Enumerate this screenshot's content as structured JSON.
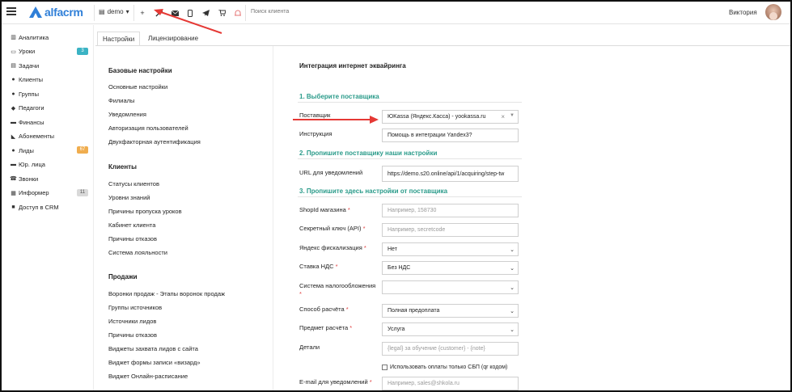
{
  "topbar": {
    "logo_text": "alfacrm",
    "account": "demo",
    "icons": [
      "plus-icon",
      "wrench-icon",
      "envelope-icon",
      "mobile-icon",
      "telegram-icon",
      "cart-icon",
      "bell-icon"
    ],
    "search_placeholder": "Поиск клиента",
    "user_name": "Виктория"
  },
  "sidebar": {
    "items": [
      {
        "label": "Аналитика",
        "icon": "dashboard-icon",
        "glyph": "▥"
      },
      {
        "label": "Уроки",
        "icon": "calendar-icon",
        "glyph": "▭",
        "badge": "3",
        "badge_color": "#3bb3c4"
      },
      {
        "label": "Задачи",
        "icon": "tasks-icon",
        "glyph": "▤"
      },
      {
        "label": "Клиенты",
        "icon": "user-icon",
        "glyph": "●"
      },
      {
        "label": "Группы",
        "icon": "users-icon",
        "glyph": "●"
      },
      {
        "label": "Педагоги",
        "icon": "graduation-cap-icon",
        "glyph": "◆"
      },
      {
        "label": "Финансы",
        "icon": "money-icon",
        "glyph": "▬"
      },
      {
        "label": "Абонементы",
        "icon": "tag-icon",
        "glyph": "◣"
      },
      {
        "label": "Лиды",
        "icon": "user-plus-icon",
        "glyph": "●",
        "badge": "67",
        "badge_color": "#f0ad4e"
      },
      {
        "label": "Юр. лица",
        "icon": "briefcase-icon",
        "glyph": "▬"
      },
      {
        "label": "Звонки",
        "icon": "phone-icon",
        "glyph": "☎"
      },
      {
        "label": "Информер",
        "icon": "inbox-icon",
        "glyph": "▦",
        "badge": "11",
        "badge_color": "#d9d9d9"
      },
      {
        "label": "Доступ в CRM",
        "icon": "lock-icon",
        "glyph": "■"
      }
    ]
  },
  "tabs": {
    "settings": "Настройки",
    "licensing": "Лицензирование"
  },
  "menu": {
    "base_head": "Базовые настройки",
    "base_items": [
      "Основные настройки",
      "Филиалы",
      "Уведомления",
      "Авторизация пользователей",
      "Двухфакторная аутентификация"
    ],
    "clients_head": "Клиенты",
    "clients_items": [
      "Статусы клиентов",
      "Уровни знаний",
      "Причины пропуска уроков",
      "Кабинет клиента",
      "Причины отказов",
      "Система лояльности"
    ],
    "sales_head": "Продажи",
    "sales_items": [
      "Воронки продаж - Этапы воронок продаж",
      "Группы источников",
      "Источники лидов",
      "Причины отказов",
      "Виджеты захвата лидов с сайта",
      "Виджет формы записи «визард»",
      "Виджет Онлайн-расписание"
    ]
  },
  "form": {
    "title": "Интеграция интернет эквайринга",
    "section1": "1. Выберите поставщика",
    "provider_label": "Поставщик",
    "provider_value": "ЮKassa (Яндекс.Касса) - yookassa.ru",
    "instruction_label": "Инструкция",
    "instruction_value": "Помощь в интеграции Yandex3?",
    "section2": "2. Пропишите поставщику наши настройки",
    "url_label": "URL для уведомлений",
    "url_value": "https://demo.s20.online/api/1/acquiring/step-tw",
    "section3": "3. Пропишите здесь настройки от поставщика",
    "shopid_label": "ShopId магазина",
    "shopid_placeholder": "Например, 158730",
    "secret_label": "Секретный ключ (API)",
    "secret_placeholder": "Например, secretcode",
    "fiscal_label": "Яндекс фискализация",
    "fiscal_value": "Нет",
    "vat_label": "Ставка НДС",
    "vat_value": "Без НДС",
    "tax_label": "Система налогообложения",
    "tax_value": "",
    "payment_method_label": "Способ расчёта",
    "payment_method_value": "Полная предоплата",
    "payment_subject_label": "Предмет расчёта",
    "payment_subject_value": "Услуга",
    "details_label": "Детали",
    "details_placeholder": "{legal} за обучение {customer} - {note}",
    "sbp_checkbox": "Использовать оплаты только СБП (qr кодом)",
    "email_label": "E-mail для уведомлений",
    "email_placeholder": "Например, sales@shkola.ru",
    "required_mark": "*"
  },
  "colors": {
    "brand": "#2f7fd8",
    "section_green": "#2a9b8a",
    "arrow_red": "#e53935",
    "required_red": "#e04040"
  }
}
